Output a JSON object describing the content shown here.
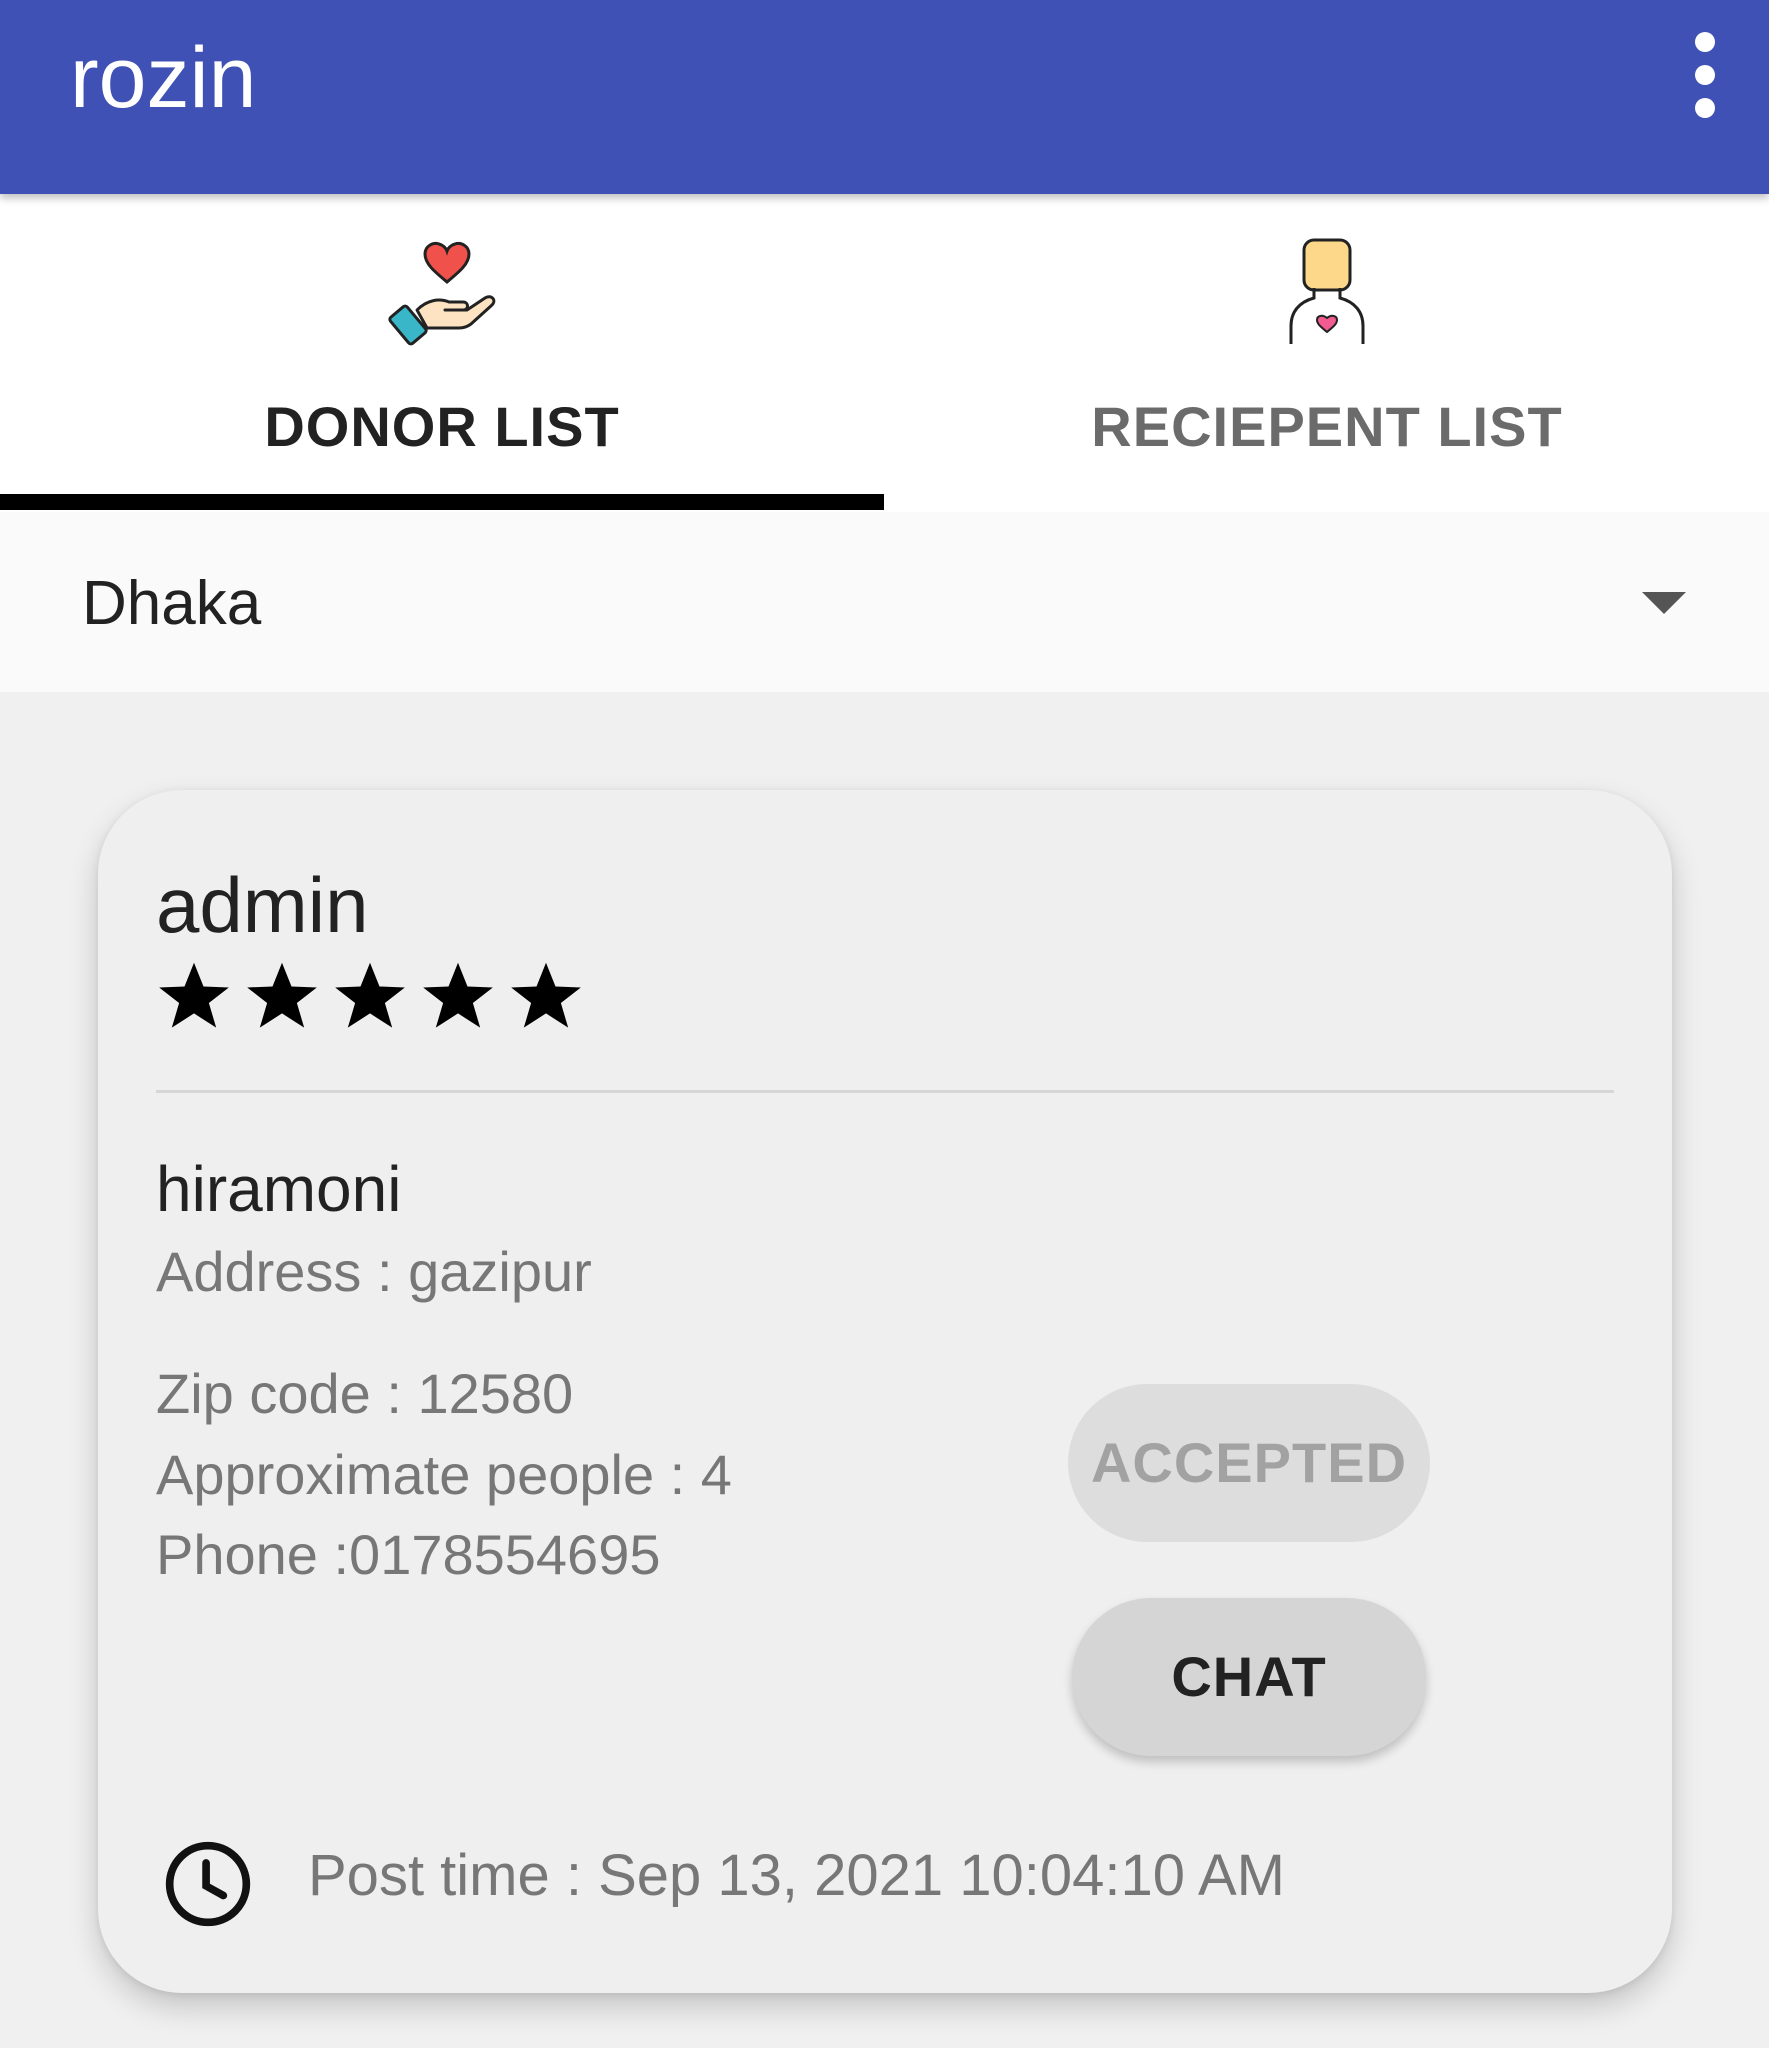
{
  "app": {
    "title": "rozin"
  },
  "colors": {
    "app_bar": "#3f51b5",
    "tab_indicator": "#000000"
  },
  "icons": {
    "overflow": "more-vert-icon",
    "donor_tab": "heart-hand-icon",
    "recipient_tab": "recipient-person-icon",
    "dropdown": "dropdown-arrow-icon",
    "time": "clock-icon",
    "rating": "star-icon"
  },
  "tabs": [
    {
      "label": "DONOR LIST",
      "selected": true
    },
    {
      "label": "RECIEPENT LIST",
      "selected": false
    }
  ],
  "location_spinner": {
    "value": "Dhaka"
  },
  "card": {
    "title": "admin",
    "rating": 5,
    "rating_max": 5,
    "name": "hiramoni",
    "address": "Address : gazipur",
    "zip": "Zip code : 12580",
    "people": "Approximate people : 4",
    "phone": "Phone :0178554695",
    "accepted_label": "ACCEPTED",
    "chat_label": "CHAT",
    "post_time": "Post time : Sep 13, 2021 10:04:10 AM"
  }
}
